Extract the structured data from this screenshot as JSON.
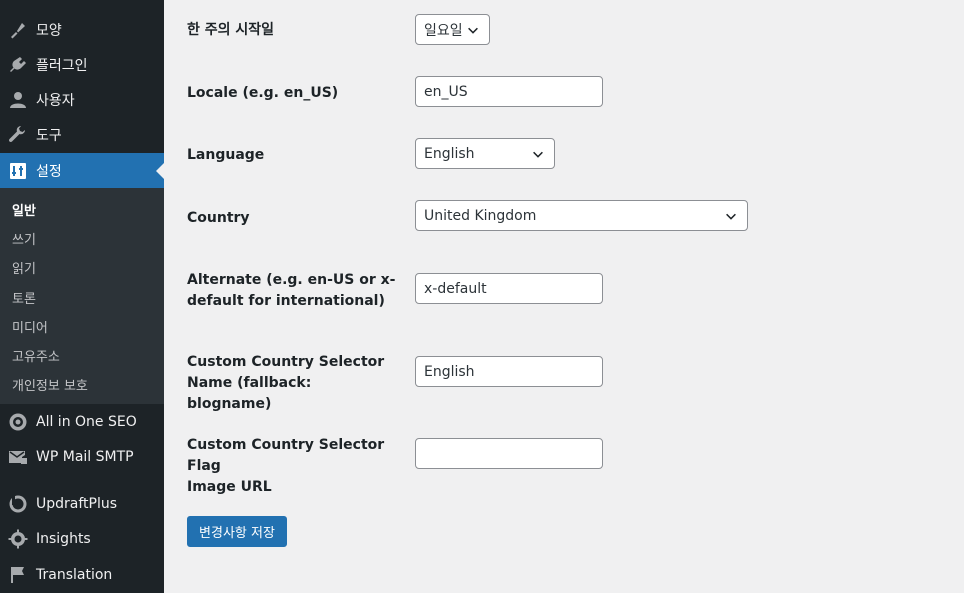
{
  "sidebar": {
    "appearance": "모양",
    "plugins": "플러그인",
    "users": "사용자",
    "tools": "도구",
    "settings": "설정",
    "submenu": [
      "일반",
      "쓰기",
      "읽기",
      "토론",
      "미디어",
      "고유주소",
      "개인정보 보호"
    ],
    "aioseo": "All in One SEO",
    "wpmail": "WP Mail SMTP",
    "updraft": "UpdraftPlus",
    "insights": "Insights",
    "translation": "Translation"
  },
  "form": {
    "week_start": {
      "label": "한 주의 시작일",
      "value": "일요일"
    },
    "locale": {
      "label": "Locale (e.g. en_US)",
      "value": "en_US"
    },
    "language": {
      "label": "Language",
      "value": "English"
    },
    "country": {
      "label": "Country",
      "value": "United Kingdom"
    },
    "alternate": {
      "label_line1": "Alternate (e.g. en-US or x-",
      "label_line2": "default for international)",
      "value": "x-default"
    },
    "selector_name": {
      "label_line1": "Custom Country Selector",
      "label_line2": "Name (fallback: blogname)",
      "value": "English"
    },
    "flag_url": {
      "label_line1": "Custom Country Selector Flag",
      "label_line2": "Image URL",
      "value": ""
    },
    "save_label": "변경사항 저장"
  }
}
